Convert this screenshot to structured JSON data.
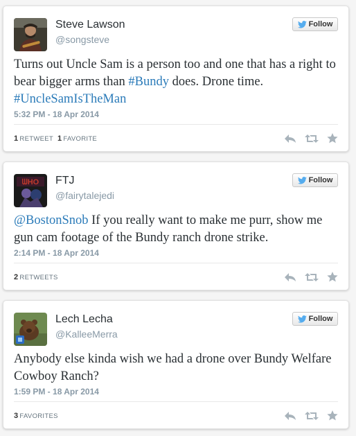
{
  "colors": {
    "link": "#2b7bb9",
    "follow_bird": "#55acee",
    "muted": "#8899a6"
  },
  "follow_label": "Follow",
  "tweets": [
    {
      "name": "Steve Lawson",
      "handle": "@songsteve",
      "text_parts": [
        "Turns out Uncle Sam is a person too and one that has a right to bear bigger arms than ",
        "#Bundy",
        " does. Drone time. ",
        "#UncleSamIsTheMan"
      ],
      "timestamp": "5:32 PM - 18 Apr 2014",
      "stats": [
        {
          "count": "1",
          "label": "RETWEET"
        },
        {
          "count": "1",
          "label": "FAVORITE"
        }
      ]
    },
    {
      "name": "FTJ",
      "handle": "@fairytalejedi",
      "text_parts": [
        "@BostonSnob",
        " If you really want to make me purr, show me gun cam footage of the Bundy ranch drone strike."
      ],
      "timestamp": "2:14 PM - 18 Apr 2014",
      "stats": [
        {
          "count": "2",
          "label": "RETWEETS"
        }
      ]
    },
    {
      "name": "Lech Lecha",
      "handle": "@KalleeMerra",
      "text_parts": [
        "Anybody else kinda wish we had a drone over Bundy Welfare Cowboy Ranch?"
      ],
      "timestamp": "1:59 PM - 18 Apr 2014",
      "stats": [
        {
          "count": "3",
          "label": "FAVORITES"
        }
      ]
    }
  ]
}
